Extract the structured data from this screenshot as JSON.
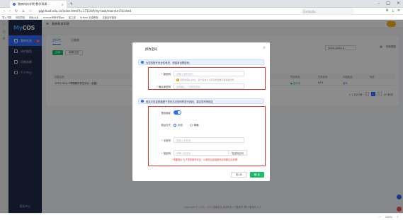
{
  "browser": {
    "tab_title": "湘南科技学院·数字资源...",
    "url": "pgp.hust.edu.cn/index.html?t=17110#/my-task/main/UnFinished",
    "search_placeholder": "Q+baidu",
    "zoom": "100%"
  },
  "bookmarks": [
    "导入书签",
    "网站导航",
    "网址大全",
    "cheque考研代购pai",
    "星之迹",
    "Python 安装教程",
    "百度百科搜索"
  ],
  "app": {
    "logo_prefix": "My",
    "logo_suffix": "COS",
    "org_name": "湘南科技学院",
    "year_select": "2023-2024-2",
    "view_toggle": "切换视图"
  },
  "sidebar": {
    "items": [
      {
        "label": "我的任务",
        "badge": "1"
      },
      {
        "label": "评价报告"
      },
      {
        "label": "问卷结果"
      },
      {
        "label": "个人中心"
      }
    ],
    "footer": "帮助中心"
  },
  "main": {
    "subtabs": [
      "进行中",
      "已结束"
    ],
    "btn_new": "全部",
    "btn_export": "填报日历",
    "table_header": [
      "问卷名称",
      "开始时间",
      "任务状态",
      "任务状态",
      "问卷数量",
      "操作"
    ],
    "table_row": [
      "2023-2024-2学期期中学生评价（标题）",
      "2024-04-05 ~ 2024-04-05",
      "● 进行中",
      "0/11",
      "填写"
    ],
    "pager": {
      "total": "1-1 共计1条",
      "current": "1",
      "page_size": "10 条/页"
    },
    "copyright": "Copyright © 2016 - 2024 湘南科技 版权所有 ICP备案号 鄂ICP备案号 A-3"
  },
  "modal": {
    "title": "修改密码",
    "notice1": "为您的账号安全性考虑，请重新设置密码。",
    "new_pwd_label": "新密码",
    "new_pwd_placeholder": "请输入新的密码",
    "pwd_hint": "密码长度8-16位，至少包含大小写字母和数字和特殊符号",
    "confirm_pwd_label": "确认新密码",
    "confirm_pwd_placeholder": "请再输入一次新的密码",
    "notice2": "绑定手机或邮箱便于您在忘记密码时进行找回，建议您尽快绑定",
    "bind_label": "是否绑定",
    "verify_label": "验证方式",
    "radio_phone": "手机",
    "radio_email": "邮箱",
    "phone_label": "手机号",
    "phone_placeholder": "请输入手机号",
    "code_label": "验证码",
    "code_placeholder": "请输入验证码",
    "code_btn": "发送验证码",
    "red_warning": "*重要提示 为了您的账号安全，以便日后找回密码请勿跳过此步骤",
    "cancel": "取 消",
    "confirm": "确 定"
  }
}
